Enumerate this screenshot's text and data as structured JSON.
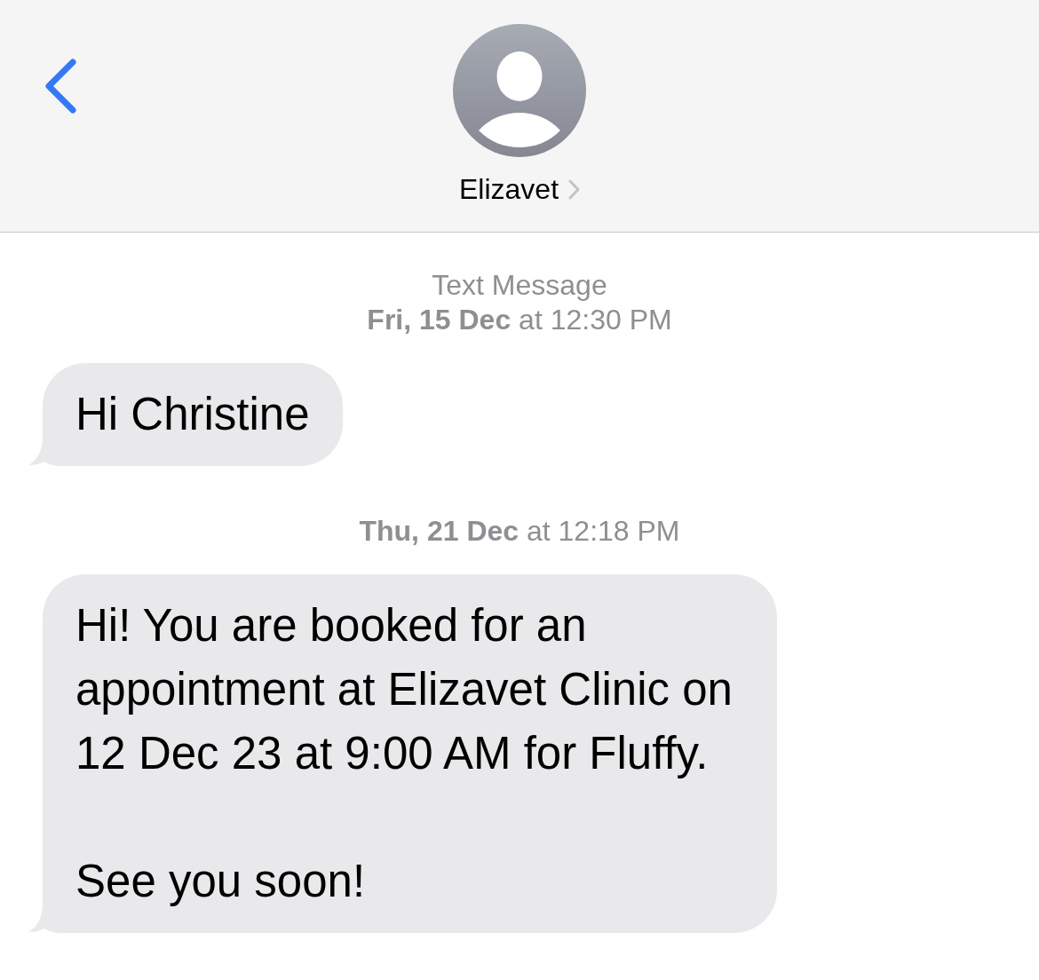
{
  "header": {
    "contact_name": "Elizavet"
  },
  "conversation": [
    {
      "kind": "timestamp",
      "service": "Text Message",
      "time": "**Fri, 15 Dec** at 12:30 PM"
    },
    {
      "kind": "message",
      "text": "Hi Christine"
    },
    {
      "kind": "timestamp",
      "time": "**Thu, 21 Dec** at 12:18 PM"
    },
    {
      "kind": "message",
      "text": "Hi! You are booked for an appointment at Elizavet Clinic on 12 Dec 23 at 9:00 AM for Fluffy.\n\nSee you soon!"
    }
  ]
}
